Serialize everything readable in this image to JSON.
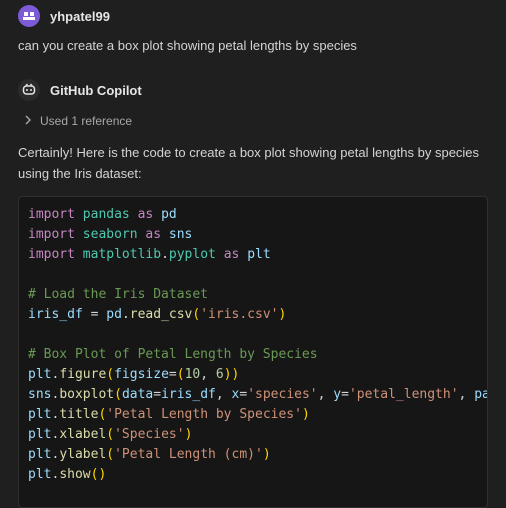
{
  "user": {
    "name": "yhpatel99",
    "avatar_icon": "user-avatar-icon"
  },
  "prompt": "can you create a box plot showing petal lengths by species",
  "assistant": {
    "name": "GitHub Copilot",
    "icon": "copilot-icon"
  },
  "references": {
    "label": "Used 1 reference"
  },
  "answer": "Certainly! Here is the code to create a box plot showing petal lengths by species using the Iris dataset:",
  "code": {
    "lines": [
      "import pandas as pd",
      "import seaborn as sns",
      "import matplotlib.pyplot as plt",
      "",
      "# Load the Iris Dataset",
      "iris_df = pd.read_csv('iris.csv')",
      "",
      "# Box Plot of Petal Length by Species",
      "plt.figure(figsize=(10, 6))",
      "sns.boxplot(data=iris_df, x='species', y='petal_length', pa",
      "plt.title('Petal Length by Species')",
      "plt.xlabel('Species')",
      "plt.ylabel('Petal Length (cm)')",
      "plt.show()"
    ]
  },
  "colors": {
    "background": "#1f1f1f",
    "code_background": "#161616",
    "avatar": "#7d5bd6",
    "keyword": "#c586c0",
    "comment": "#6a9955",
    "string": "#ce9178"
  }
}
